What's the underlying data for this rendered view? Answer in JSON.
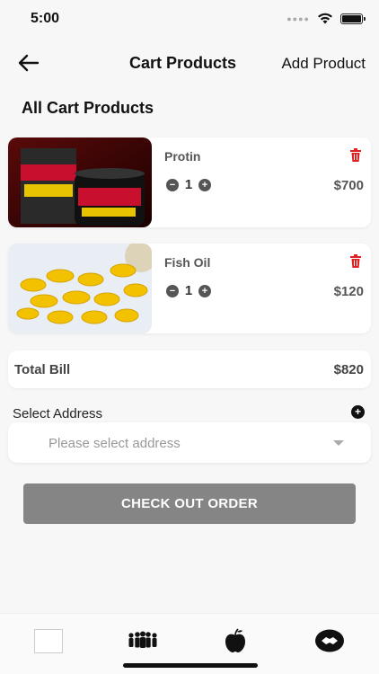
{
  "status_bar": {
    "time": "5:00"
  },
  "header": {
    "title": "Cart Products",
    "add_product_label": "Add Product"
  },
  "section_title": "All Cart Products",
  "cart_items": [
    {
      "name": "Protin",
      "quantity": "1",
      "price": "$700"
    },
    {
      "name": "Fish Oil",
      "quantity": "1",
      "price": "$120"
    }
  ],
  "summary": {
    "total_label": "Total Bill",
    "total_value": "$820"
  },
  "address": {
    "label": "Select Address",
    "placeholder": "Please select address"
  },
  "checkout_label": "CHECK OUT ORDER",
  "colors": {
    "delete": "#e02020",
    "checkout_button": "#858585"
  },
  "tab_icons": [
    "blank-square-icon",
    "people-icon",
    "apple-icon",
    "handshake-icon"
  ]
}
